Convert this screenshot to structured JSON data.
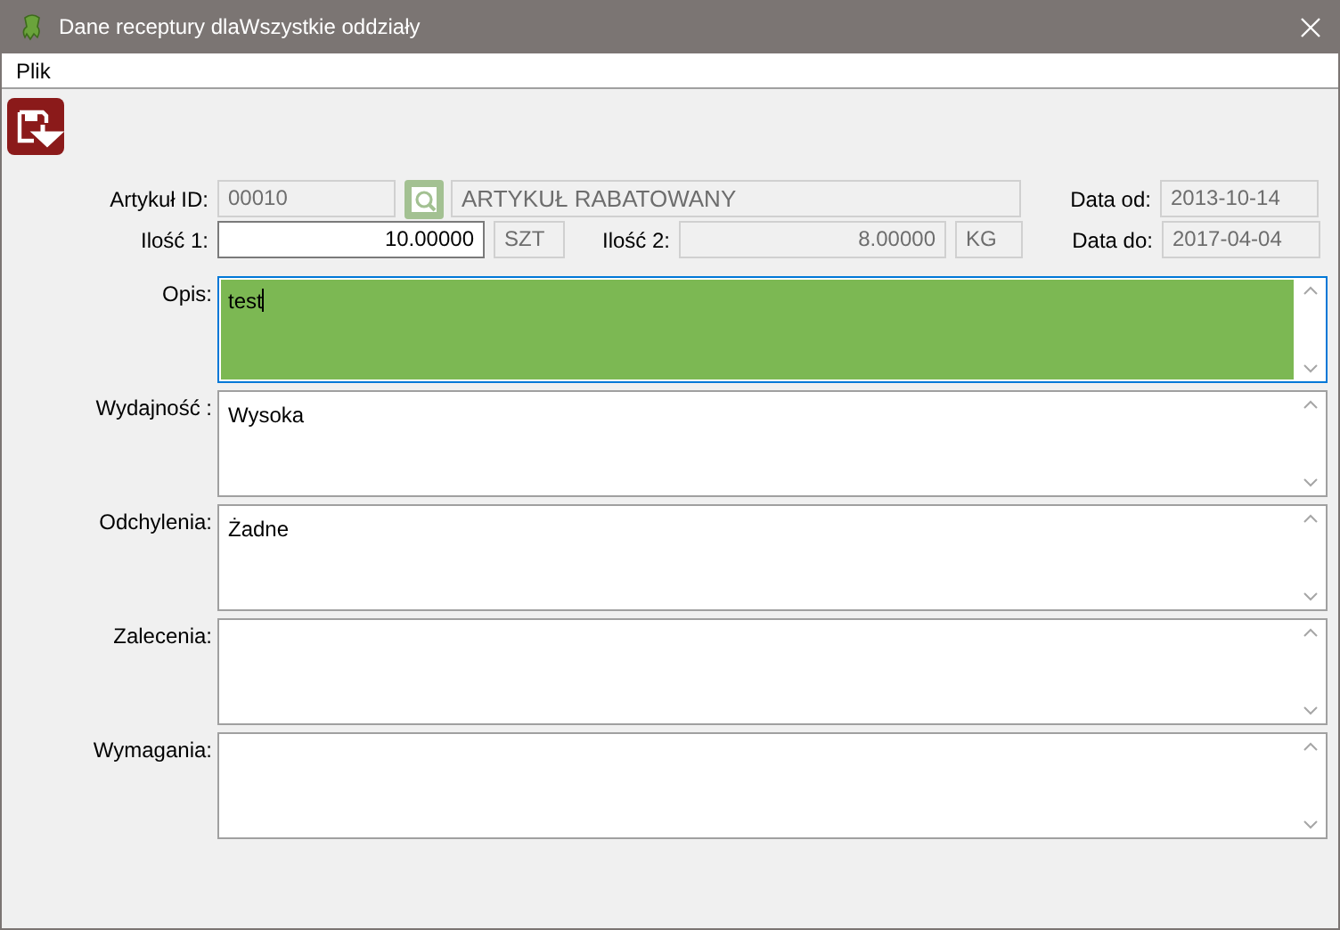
{
  "window": {
    "title": "Dane receptury dlaWszystkie oddziały"
  },
  "menu": [
    {
      "label": "Plik"
    }
  ],
  "header": {
    "article_id": {
      "label": "Artykuł ID:",
      "value": "00010",
      "disabled": true
    },
    "article_name": {
      "value": "ARTYKUŁ RABATOWANY",
      "disabled": true
    },
    "qty1": {
      "label": "Ilość 1:",
      "value": "10.00000",
      "unit": "SZT",
      "disabled": false
    },
    "qty2": {
      "label": "Ilość 2:",
      "value": "8.00000",
      "unit": "KG",
      "disabled": true
    },
    "date_from": {
      "label": "Data od:",
      "value": "2013-10-14",
      "disabled": true
    },
    "date_to": {
      "label": "Data do:",
      "value": "2017-04-04",
      "disabled": true
    }
  },
  "memos": [
    {
      "label": "Opis:",
      "value": "test",
      "focused": true
    },
    {
      "label": "Wydajność :",
      "value": "Wysoka",
      "focused": false
    },
    {
      "label": "Odchylenia:",
      "value": "Żadne",
      "focused": false
    },
    {
      "label": "Zalecenia:",
      "focused": false
    },
    {
      "label": "Wymagania:",
      "focused": false
    }
  ]
}
